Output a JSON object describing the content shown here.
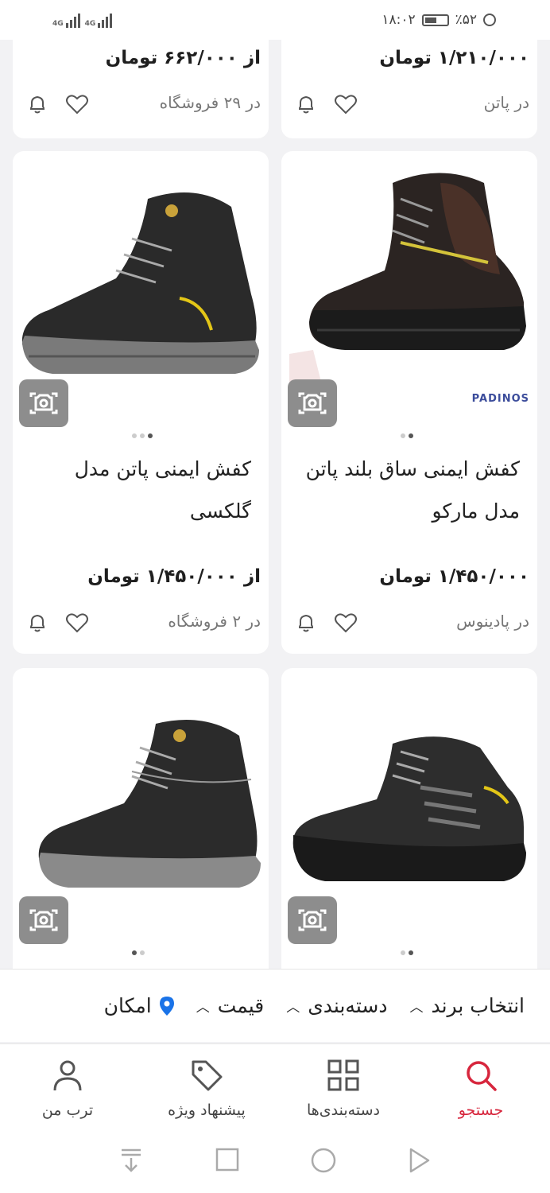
{
  "status_bar": {
    "time": "۱۸:۰۲",
    "battery": "٪۵۲",
    "network_1": "4G",
    "network_2": "4G"
  },
  "products": [
    {
      "price": "۱/۲۱۰/۰۰۰ تومان",
      "seller": "در پاتن"
    },
    {
      "price": "از ۶۶۲/۰۰۰ تومان",
      "seller": "در ۲۹ فروشگاه"
    },
    {
      "title": "کفش ایمنی ساق بلند پاتن مدل مارکو",
      "price": "۱/۴۵۰/۰۰۰ تومان",
      "seller": "در پادینوس",
      "brand_mark": "PADINOS",
      "image_count": 2,
      "image_index": 1
    },
    {
      "title": "کفش ایمنی پاتن مدل گلکسی",
      "price": "از ۱/۴۵۰/۰۰۰ تومان",
      "seller": "در ۲ فروشگاه",
      "image_count": 3,
      "image_index": 2
    },
    {
      "image_count": 2,
      "image_index": 1
    },
    {
      "image_count": 2,
      "image_index": 0
    }
  ],
  "filters": [
    {
      "label": "انتخاب برند",
      "icon": "chevron-up-icon"
    },
    {
      "label": "دسته‌بندی",
      "icon": "chevron-up-icon"
    },
    {
      "label": "قیمت",
      "icon": "chevron-up-icon"
    },
    {
      "label": "امکان",
      "icon": "location-pin-icon"
    }
  ],
  "bottom_nav": [
    {
      "label": "جستجو",
      "icon": "search-icon",
      "active": true
    },
    {
      "label": "دسته‌بندی‌ها",
      "icon": "grid-icon",
      "active": false
    },
    {
      "label": "پیشنهاد ویژه",
      "icon": "tag-icon",
      "active": false
    },
    {
      "label": "ترب من",
      "icon": "user-icon",
      "active": false
    }
  ],
  "colors": {
    "accent": "#d7263d",
    "pin": "#1a73e8"
  }
}
